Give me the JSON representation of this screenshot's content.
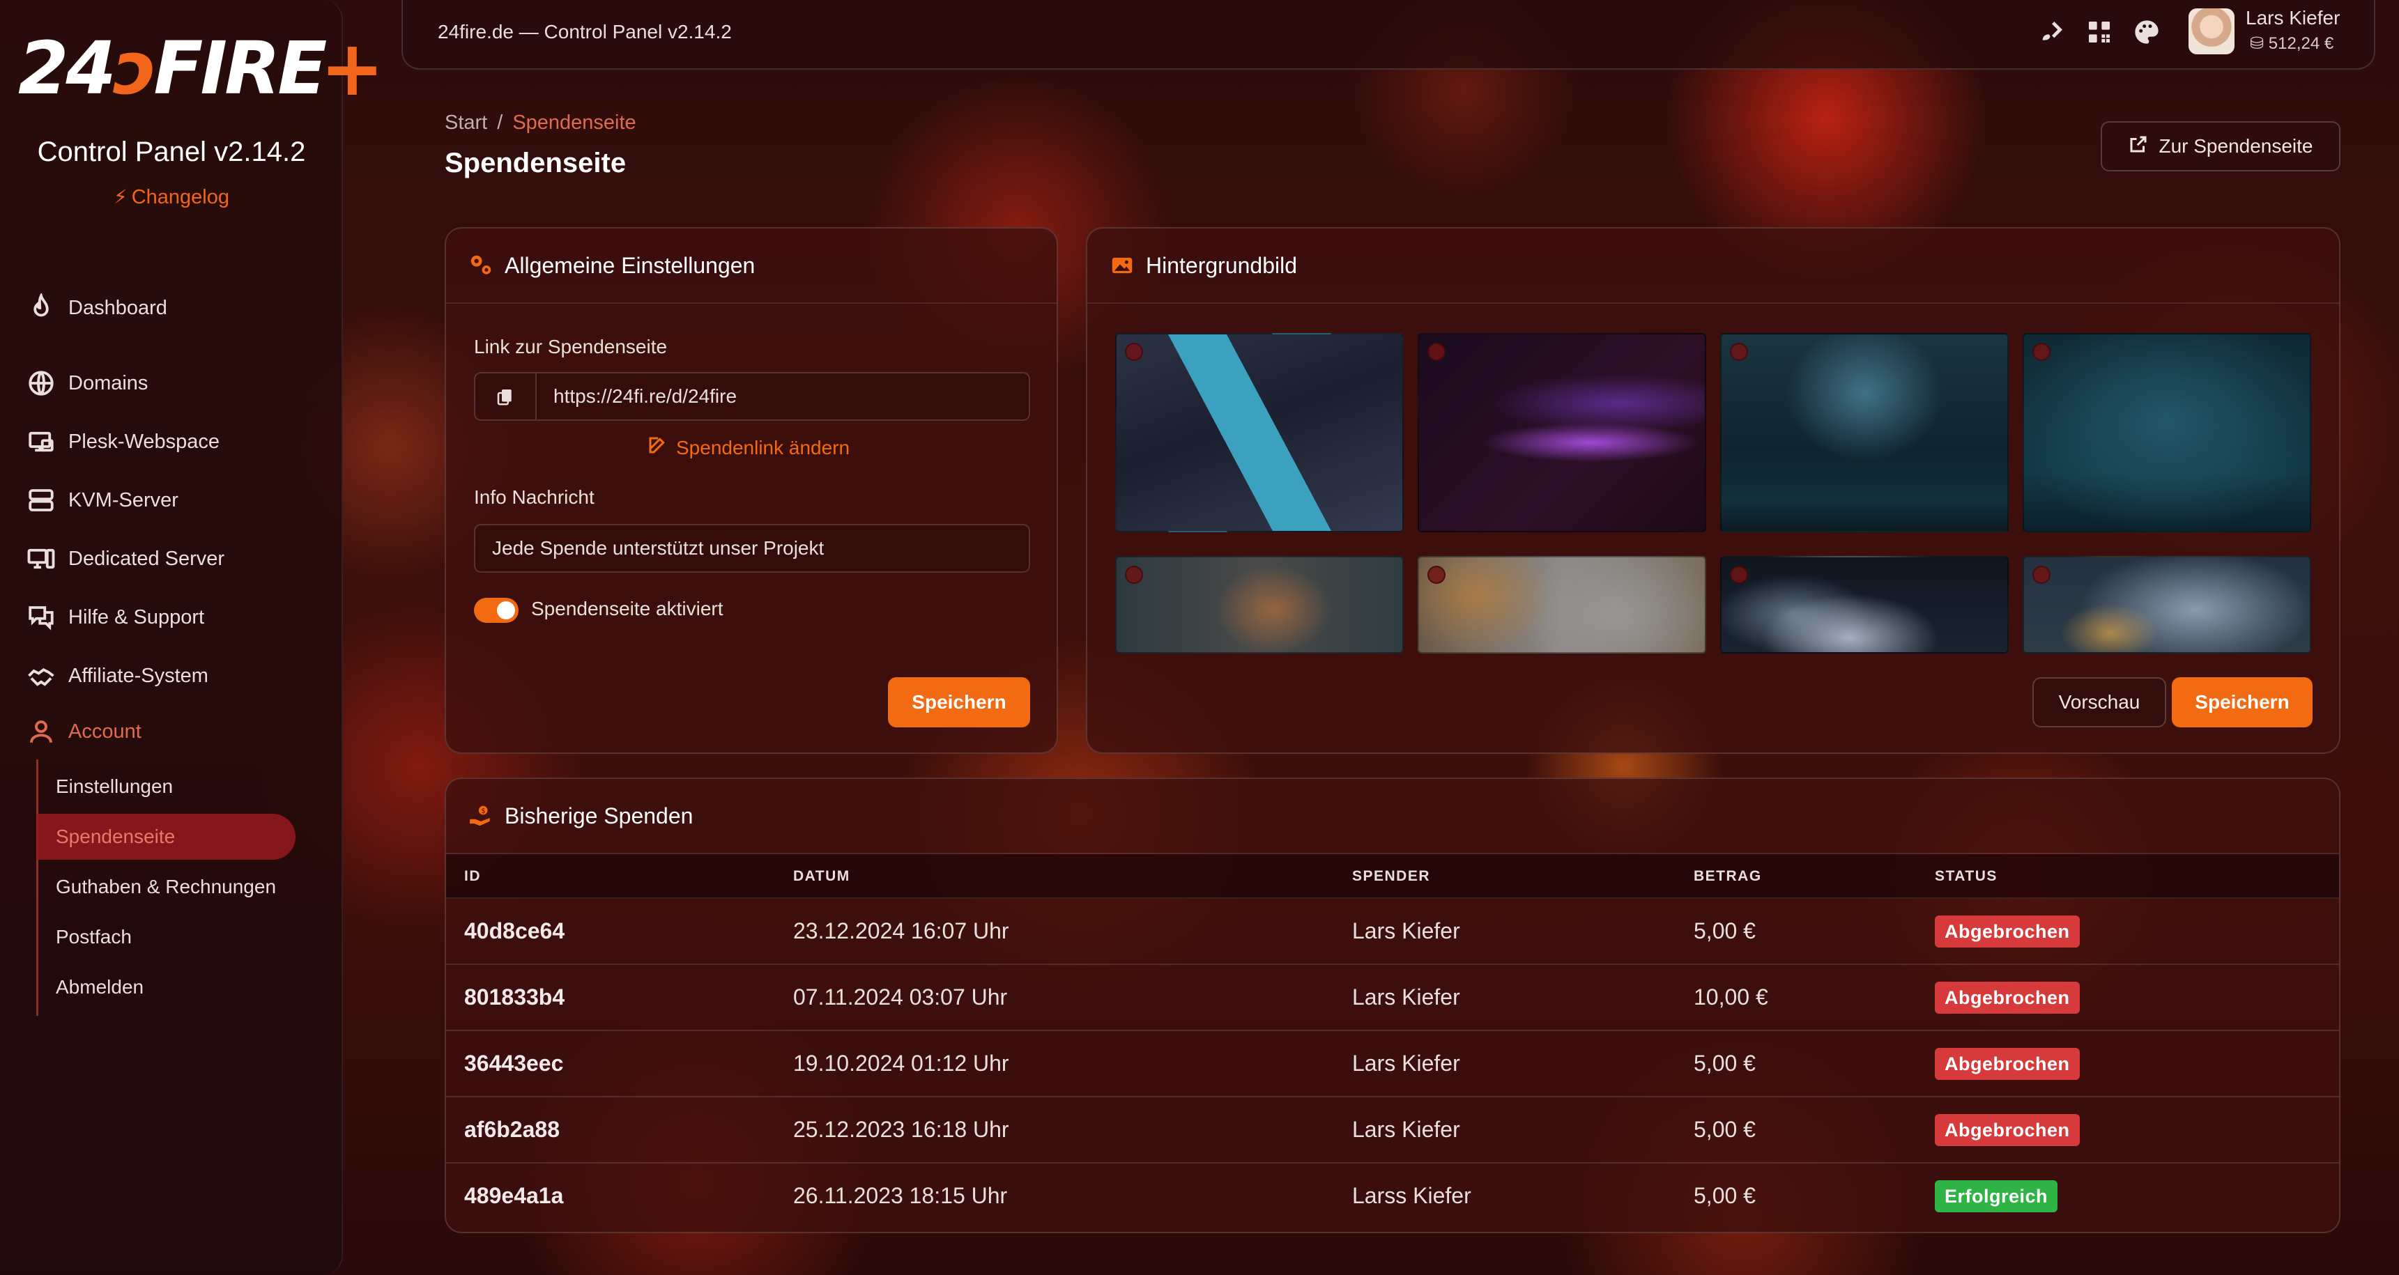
{
  "app": {
    "window_title": "24fire.de — Control Panel v2.14.2",
    "logo_text": "24FIRE+",
    "panel_title": "Control Panel v2.14.2",
    "changelog": "Changelog"
  },
  "user": {
    "name": "Lars Kiefer",
    "balance": "512,24 €"
  },
  "sidebar": {
    "items": [
      {
        "label": "Dashboard",
        "icon": "flame-icon"
      },
      {
        "label": "Domains",
        "icon": "globe-icon"
      },
      {
        "label": "Plesk-Webspace",
        "icon": "webspace-icon"
      },
      {
        "label": "KVM-Server",
        "icon": "server-icon"
      },
      {
        "label": "Dedicated Server",
        "icon": "dedicated-server-icon"
      },
      {
        "label": "Hilfe & Support",
        "icon": "support-icon"
      },
      {
        "label": "Affiliate-System",
        "icon": "handshake-icon"
      },
      {
        "label": "Account",
        "icon": "user-icon"
      }
    ],
    "account_sub": [
      {
        "label": "Einstellungen"
      },
      {
        "label": "Spendenseite",
        "active": true
      },
      {
        "label": "Guthaben & Rechnungen"
      },
      {
        "label": "Postfach"
      },
      {
        "label": "Abmelden"
      }
    ]
  },
  "header": {
    "breadcrumb": [
      "Start",
      "/",
      "Spendenseite"
    ],
    "title": "Spendenseite",
    "donation_page_button": "Zur Spendenseite"
  },
  "settings": {
    "title": "Allgemeine Einstellungen",
    "link_label": "Link zur Spendenseite",
    "link_value": "https://24fi.re/d/24fire",
    "change_link": "Spendenlink ändern",
    "info_label": "Info Nachricht",
    "info_value": "Jede Spende unterstützt unser Projekt",
    "toggle_label": "Spendenseite aktiviert",
    "toggle_on": true,
    "save_label": "Speichern"
  },
  "background": {
    "title": "Hintergrundbild",
    "images": [
      {
        "name": "geometric-blue"
      },
      {
        "name": "purple-smoke-wave"
      },
      {
        "name": "blue-spotlight-stage"
      },
      {
        "name": "teal-wall"
      },
      {
        "name": "dark-smoke-orange"
      },
      {
        "name": "grey-orange-smoke"
      },
      {
        "name": "blue-cloud-smoke"
      },
      {
        "name": "blue-smoke-orange"
      }
    ],
    "preview_label": "Vorschau",
    "save_label": "Speichern"
  },
  "donations": {
    "title": "Bisherige Spenden",
    "columns": [
      "ID",
      "DATUM",
      "SPENDER",
      "BETRAG",
      "STATUS"
    ],
    "rows": [
      {
        "id": "40d8ce64",
        "date": "23.12.2024 16:07 Uhr",
        "donor": "Lars Kiefer",
        "amount": "5,00 €",
        "status": "Abgebrochen"
      },
      {
        "id": "801833b4",
        "date": "07.11.2024 03:07 Uhr",
        "donor": "Lars Kiefer",
        "amount": "10,00 €",
        "status": "Abgebrochen"
      },
      {
        "id": "36443eec",
        "date": "19.10.2024 01:12 Uhr",
        "donor": "Lars Kiefer",
        "amount": "5,00 €",
        "status": "Abgebrochen"
      },
      {
        "id": "af6b2a88",
        "date": "25.12.2023 16:18 Uhr",
        "donor": "Lars Kiefer",
        "amount": "5,00 €",
        "status": "Abgebrochen"
      },
      {
        "id": "489e4a1a",
        "date": "26.11.2023 18:15 Uhr",
        "donor": "Larss Kiefer",
        "amount": "5,00 €",
        "status": "Erfolgreich"
      }
    ]
  },
  "colors": {
    "accent": "#f26a12",
    "status_cancelled": "#d63a3a",
    "status_success": "#2fb344"
  }
}
